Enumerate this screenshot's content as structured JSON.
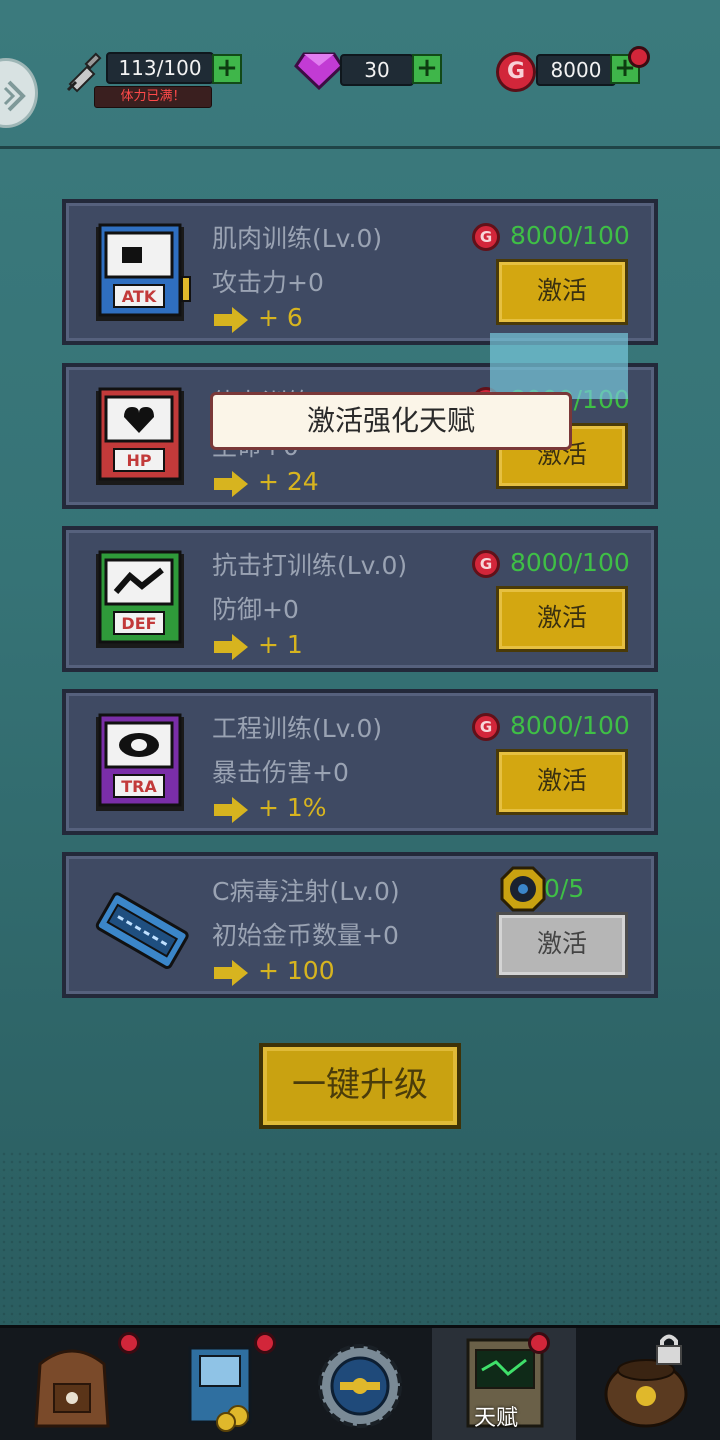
{
  "header": {
    "stamina": "113/100",
    "stamina_note": "体力已满！",
    "gems": "30",
    "gold": "8000",
    "plus": "+"
  },
  "talents": [
    {
      "title": "肌肉训练(Lv.0)",
      "effect": "攻击力+0",
      "gain": "+ 6",
      "cost": "8000/100",
      "button": "激活",
      "book_label": "ATK",
      "book_color": "#2f6fc0"
    },
    {
      "title": "体力训练(Lv.0)",
      "effect": "生命+0",
      "gain": "+ 24",
      "cost": "8000/100",
      "button": "激活",
      "book_label": "HP",
      "book_color": "#c23a3a"
    },
    {
      "title": "抗击打训练(Lv.0)",
      "effect": "防御+0",
      "gain": "+ 1",
      "cost": "8000/100",
      "button": "激活",
      "book_label": "DEF",
      "book_color": "#2f9a3a"
    },
    {
      "title": "工程训练(Lv.0)",
      "effect": "暴击伤害+0",
      "gain": "+ 1%",
      "cost": "8000/100",
      "button": "激活",
      "book_label": "TRA",
      "book_color": "#7a2ea8"
    },
    {
      "title": "C病毒注射(Lv.0)",
      "effect": "初始金币数量+0",
      "gain": "+ 100",
      "cost": "0/5",
      "button": "激活",
      "book_label": "",
      "book_color": "#3b86c9"
    }
  ],
  "cost_icon_letter": "G",
  "upgrade_all": "一键升级",
  "tooltip": "激活强化天赋",
  "nav": {
    "active_label": "天赋"
  },
  "colors": {
    "gold_button": "#d3a711",
    "cost_green": "#3fbf46",
    "gain_yellow": "#d7b41f",
    "card_bg": "#3f4a63",
    "badge_red": "#d2263a"
  }
}
